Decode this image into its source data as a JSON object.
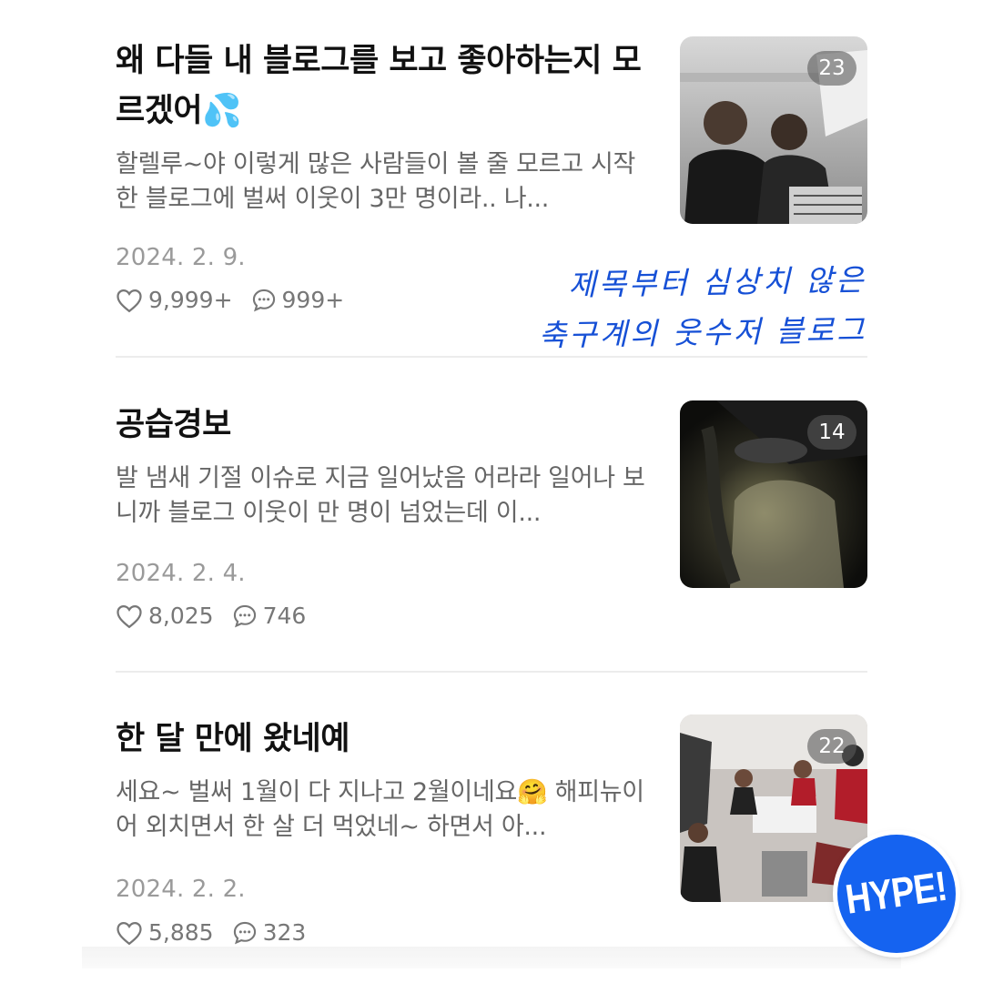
{
  "posts": [
    {
      "title": "왜 다들 내 블로그를 보고 좋아하는지 모르겠어💦",
      "excerpt": "할렐루~야 이렇게 많은 사람들이 볼 줄 모르고 시작한 블로그에 벌써 이웃이 3만 명이라.. 나...",
      "date": "2024. 2. 9.",
      "likes": "9,999+",
      "comments": "999+",
      "photo_count": "23"
    },
    {
      "title": "공습경보",
      "excerpt": "발 냄새 기절 이슈로 지금 일어났음 어라라 일어나 보니까 블로그 이웃이 만 명이 넘었는데 이...",
      "date": "2024. 2. 4.",
      "likes": "8,025",
      "comments": "746",
      "photo_count": "14"
    },
    {
      "title": "한 달 만에 왔네예",
      "excerpt": "세요~ 벌써 1월이 다 지나고 2월이네요🤗  해피뉴이어 외치면서 한 살 더 먹었네~ 하면서 아...",
      "date": "2024. 2. 2.",
      "likes": "5,885",
      "comments": "323",
      "photo_count": "22"
    }
  ],
  "annotation": {
    "line1": "제목부터 심상치 않은",
    "line2": "축구계의 웃수저 블로그"
  },
  "sticker": {
    "label": "HYPE!"
  },
  "icons": {
    "like": "heart-icon",
    "comment": "comment-bubble-icon"
  },
  "colors": {
    "annotation": "#1650d6",
    "sticker": "#1563f0"
  }
}
